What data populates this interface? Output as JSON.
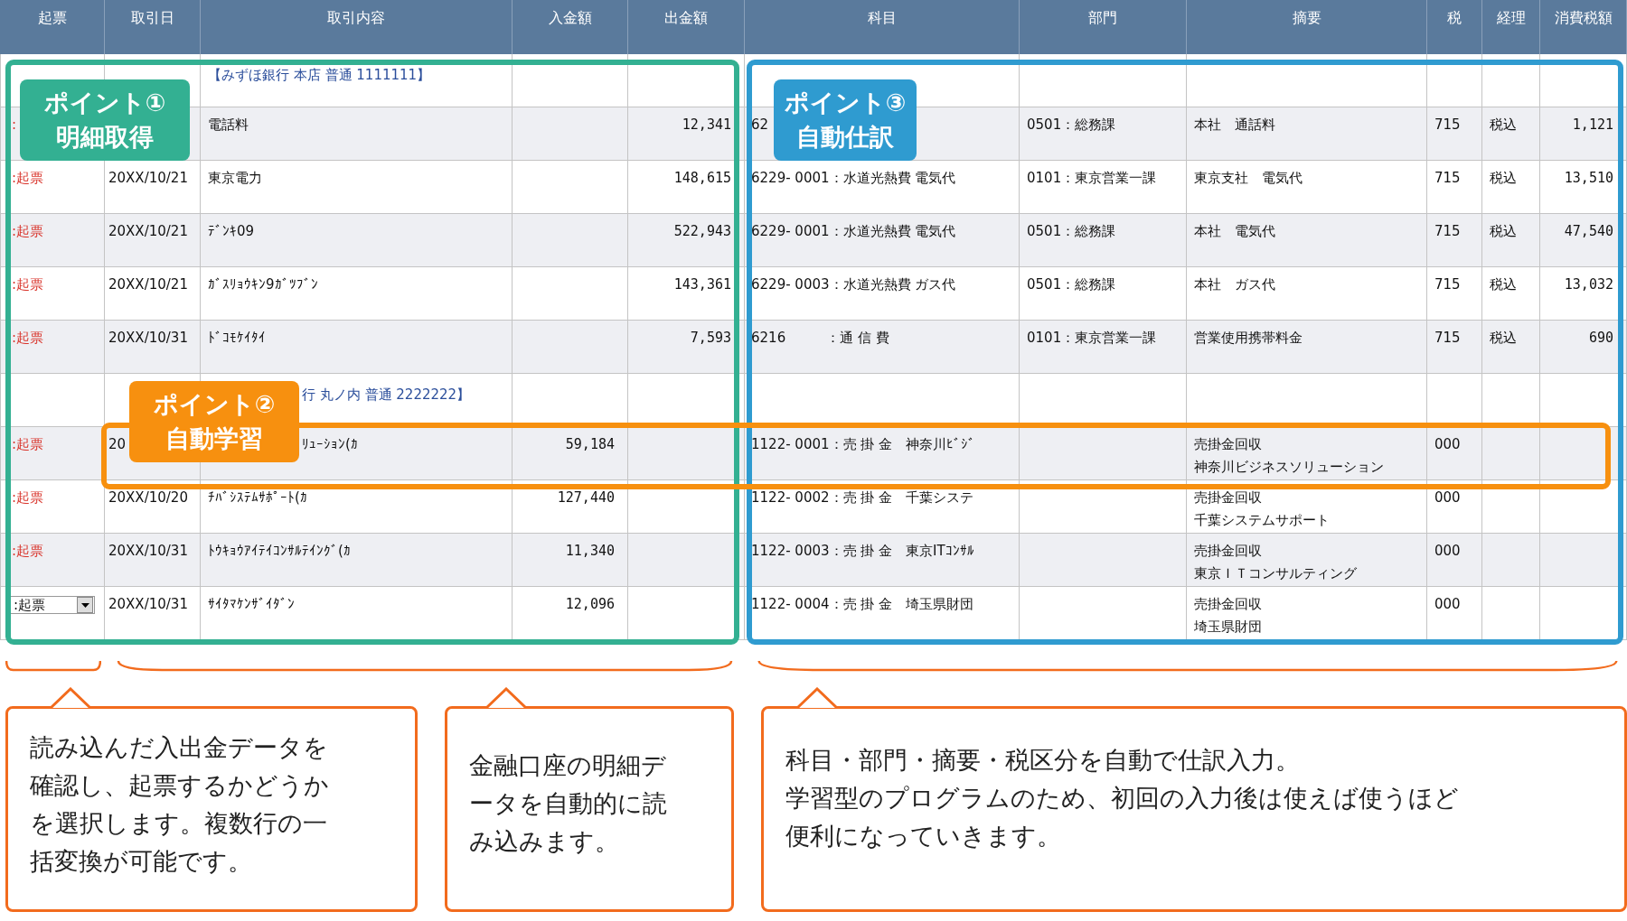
{
  "table": {
    "columns": [
      "起票",
      "取引日",
      "取引内容",
      "入金額",
      "出金額",
      "科目",
      "部門",
      "摘要",
      "税",
      "経理",
      "消費税額"
    ],
    "rows": [
      {
        "kind": "bank",
        "text": "【みずほ銀行 本店 普通 1111111】"
      },
      {
        "kind": "entry",
        "voucher": ":",
        "content": "電話料",
        "withdrawal": "12,341",
        "account": "62",
        "department": "0501：総務課",
        "summary": [
          "本社　通話料"
        ],
        "tax": "715",
        "accounting": "税込",
        "tax_amount": "1,121"
      },
      {
        "kind": "entry",
        "voucher": ":起票",
        "date": "20XX/10/21",
        "content": "東京電力",
        "withdrawal": "148,615",
        "account": "6229- 0001：水道光熱費 電気代",
        "department": "0101：東京営業一課",
        "summary": [
          "東京支社　電気代"
        ],
        "tax": "715",
        "accounting": "税込",
        "tax_amount": "13,510"
      },
      {
        "kind": "entry",
        "voucher": ":起票",
        "date": "20XX/10/21",
        "content": "ﾃﾞﾝｷ09",
        "withdrawal": "522,943",
        "account": "6229- 0001：水道光熱費 電気代",
        "department": "0501：総務課",
        "summary": [
          "本社　電気代"
        ],
        "tax": "715",
        "accounting": "税込",
        "tax_amount": "47,540"
      },
      {
        "kind": "entry",
        "voucher": ":起票",
        "date": "20XX/10/21",
        "content": "ｶﾞｽﾘｮｳｷﾝ9ｶﾞﾂﾌﾞﾝ",
        "withdrawal": "143,361",
        "account": "6229- 0003：水道光熱費 ガス代",
        "department": "0501：総務課",
        "summary": [
          "本社　ガス代"
        ],
        "tax": "715",
        "accounting": "税込",
        "tax_amount": "13,032"
      },
      {
        "kind": "entry",
        "voucher": ":起票",
        "date": "20XX/10/31",
        "content": "ﾄﾞｺﾓｹｲﾀｲ",
        "withdrawal": "7,593",
        "account": "6216　　　：通 信 費",
        "department": "0101：東京営業一課",
        "summary": [
          "営業使用携帯料金"
        ],
        "tax": "715",
        "accounting": "税込",
        "tax_amount": "690"
      },
      {
        "kind": "bank",
        "text": "行 丸ノ内 普通 2222222】"
      },
      {
        "kind": "entry",
        "voucher": ":起票",
        "date": "20",
        "content": "ﾘｭｰｼｮﾝ(ｶ",
        "deposit": "59,184",
        "account": "1122- 0001：売 掛 金　神奈川ﾋﾞｼﾞ",
        "summary": [
          "売掛金回収",
          "神奈川ビジネスソリューション"
        ],
        "tax": "000"
      },
      {
        "kind": "entry",
        "voucher": ":起票",
        "date": "20XX/10/20",
        "content": "ﾁﾊﾞｼｽﾃﾑｻﾎﾟｰﾄ(ｶ",
        "deposit": "127,440",
        "account": "1122- 0002：売 掛 金　千葉システ",
        "summary": [
          "売掛金回収",
          "千葉システムサポート"
        ],
        "tax": "000"
      },
      {
        "kind": "entry",
        "voucher": ":起票",
        "date": "20XX/10/31",
        "content": "ﾄｳｷｮｳｱｲﾃｲｺﾝｻﾙﾃｲﾝｸﾞ(ｶ",
        "deposit": "11,340",
        "account": "1122- 0003：売 掛 金　東京ITｺﾝｻﾙ",
        "summary": [
          "売掛金回収",
          "東京ＩＴコンサルティング"
        ],
        "tax": "000"
      },
      {
        "kind": "entry",
        "voucher_select": ":起票",
        "date": "20XX/10/31",
        "content": "ｻｲﾀﾏｹﾝｻﾞｲﾀﾞﾝ",
        "deposit": "12,096",
        "account": "1122- 0004：売 掛 金　埼玉県財団",
        "summary": [
          "売掛金回収",
          "埼玉県財団"
        ],
        "tax": "000"
      }
    ]
  },
  "points": [
    {
      "kind": "green",
      "lines": [
        "ポイント①",
        "明細取得"
      ]
    },
    {
      "kind": "blue",
      "lines": [
        "ポイント③",
        "自動仕訳"
      ]
    },
    {
      "kind": "orange",
      "lines": [
        "ポイント②",
        "自動学習"
      ]
    }
  ],
  "callouts": [
    {
      "kind": "narrow",
      "text": "読み込んだ入出金データを確認し、起票するかどうかを選択します。複数行の一括変換が可能です。"
    },
    {
      "kind": "small",
      "text": "金融口座の明細データを自動的に読み込みます。"
    },
    {
      "kind": "wide",
      "lines": [
        "科目・部門・摘要・税区分を自動で仕訳入力。",
        "学習型のプログラムのため、初回の入力後は使えば使うほど",
        "便利になっていきます。"
      ]
    }
  ]
}
